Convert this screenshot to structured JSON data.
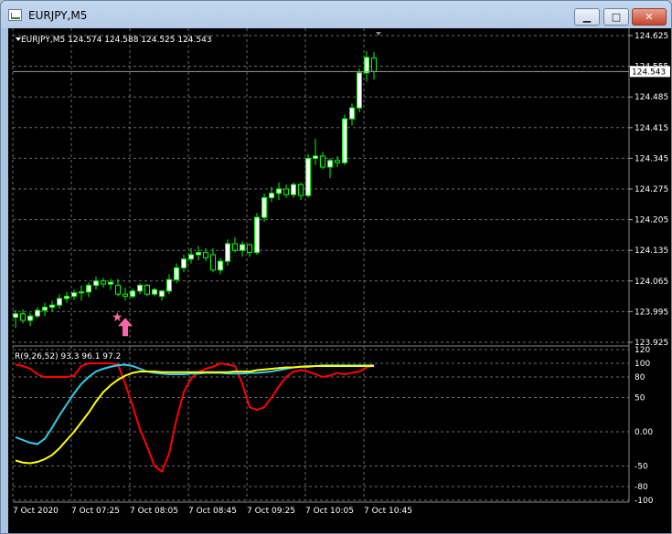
{
  "window": {
    "title": "EURJPY,M5",
    "min_glyph": "▁",
    "max_glyph": "□",
    "close_glyph": "✕"
  },
  "chart": {
    "symbol_line": "EURJPY,M5  124.574 124.588 124.525 124.543",
    "current_price_label": "124.543",
    "hidden_label": "124.555",
    "indicator_label": "R(9,26,52) 93.3 96.1 97.2",
    "colors": {
      "background": "#000000",
      "grid": "#6b6b6b",
      "bull_body": "#ffffff",
      "candle_outline": "#00ff00",
      "bear_body": "#000000",
      "ind_red": "#ff0000",
      "ind_cyan": "#33ccee",
      "ind_yellow": "#ffff00",
      "arrow": "#ff66aa"
    }
  },
  "chart_data": [
    {
      "type": "candlestick",
      "title": "EURJPY,M5",
      "ohlc_header": [
        124.574,
        124.588,
        124.525,
        124.543
      ],
      "price_ticks": [
        "124.625",
        "124.555",
        "124.485",
        "124.415",
        "124.345",
        "124.275",
        "124.205",
        "124.135",
        "124.065",
        "123.995",
        "123.925"
      ],
      "ylim": [
        123.925,
        124.625
      ],
      "current_price": 124.543,
      "time_labels": [
        "7 Oct 2020",
        "7 Oct 07:25",
        "7 Oct 08:05",
        "7 Oct 08:45",
        "7 Oct 09:25",
        "7 Oct 10:05",
        "7 Oct 10:45"
      ],
      "grid": true,
      "candles": [
        [
          123.982,
          123.999,
          123.958,
          123.99
        ],
        [
          123.99,
          124.0,
          123.968,
          123.975
        ],
        [
          123.975,
          123.992,
          123.962,
          123.985
        ],
        [
          123.985,
          124.005,
          123.98,
          123.998
        ],
        [
          123.998,
          124.015,
          123.985,
          124.005
        ],
        [
          124.005,
          124.02,
          123.995,
          124.01
        ],
        [
          124.01,
          124.035,
          124.002,
          124.025
        ],
        [
          124.025,
          124.04,
          124.015,
          124.03
        ],
        [
          124.03,
          124.045,
          124.022,
          124.038
        ],
        [
          124.038,
          124.055,
          124.02,
          124.04
        ],
        [
          124.04,
          124.062,
          124.028,
          124.055
        ],
        [
          124.055,
          124.075,
          124.045,
          124.065
        ],
        [
          124.065,
          124.072,
          124.05,
          124.058
        ],
        [
          124.058,
          124.07,
          124.045,
          124.062
        ],
        [
          124.055,
          124.07,
          124.03,
          124.035
        ],
        [
          124.035,
          124.05,
          124.02,
          124.03
        ],
        [
          124.03,
          124.048,
          124.025,
          124.042
        ],
        [
          124.042,
          124.06,
          124.035,
          124.055
        ],
        [
          124.055,
          124.058,
          124.03,
          124.035
        ],
        [
          124.035,
          124.05,
          124.03,
          124.045
        ],
        [
          124.03,
          124.045,
          124.02,
          124.042
        ],
        [
          124.042,
          124.08,
          124.035,
          124.068
        ],
        [
          124.068,
          124.105,
          124.06,
          124.095
        ],
        [
          124.095,
          124.125,
          124.085,
          124.115
        ],
        [
          124.115,
          124.14,
          124.105,
          124.125
        ],
        [
          124.125,
          124.145,
          124.112,
          124.13
        ],
        [
          124.13,
          124.14,
          124.11,
          124.118
        ],
        [
          124.125,
          124.14,
          124.085,
          124.09
        ],
        [
          124.09,
          124.118,
          124.08,
          124.11
        ],
        [
          124.11,
          124.16,
          124.1,
          124.15
        ],
        [
          124.15,
          124.165,
          124.13,
          124.135
        ],
        [
          124.135,
          124.155,
          124.12,
          124.148
        ],
        [
          124.148,
          124.15,
          124.12,
          124.13
        ],
        [
          124.13,
          124.22,
          124.125,
          124.21
        ],
        [
          124.21,
          124.265,
          124.2,
          124.255
        ],
        [
          124.255,
          124.28,
          124.245,
          124.265
        ],
        [
          124.265,
          124.29,
          124.25,
          124.275
        ],
        [
          124.275,
          124.285,
          124.255,
          124.262
        ],
        [
          124.262,
          124.29,
          124.255,
          124.285
        ],
        [
          124.285,
          124.29,
          124.25,
          124.26
        ],
        [
          124.26,
          124.355,
          124.255,
          124.345
        ],
        [
          124.345,
          124.39,
          124.33,
          124.35
        ],
        [
          124.35,
          124.36,
          124.32,
          124.325
        ],
        [
          124.325,
          124.345,
          124.3,
          124.34
        ],
        [
          124.34,
          124.35,
          124.325,
          124.335
        ],
        [
          124.335,
          124.445,
          124.33,
          124.435
        ],
        [
          124.435,
          124.47,
          124.42,
          124.46
        ],
        [
          124.46,
          124.55,
          124.45,
          124.54
        ],
        [
          124.54,
          124.59,
          124.52,
          124.575
        ],
        [
          124.574,
          124.588,
          124.525,
          124.543
        ]
      ],
      "markers": [
        {
          "type": "star",
          "candle": 14,
          "price": 123.983
        },
        {
          "type": "up-arrow",
          "candle": 15,
          "price": 123.96
        }
      ]
    },
    {
      "type": "line",
      "title": "R(9,26,52)",
      "current_values": [
        93.3,
        96.1,
        97.2
      ],
      "ylim": [
        -100,
        120
      ],
      "y_ticks": [
        "120",
        "100",
        "80",
        "50",
        "0.00",
        "-50",
        "-80",
        "-100"
      ],
      "series": [
        {
          "color": "#ff0000",
          "values": [
            98,
            96,
            92,
            84,
            80,
            80,
            80,
            80,
            82,
            96,
            100,
            100,
            100,
            100,
            98,
            70,
            38,
            4,
            -22,
            -50,
            -58,
            -32,
            18,
            58,
            78,
            87,
            92,
            95,
            100,
            98,
            96,
            70,
            36,
            32,
            36,
            50,
            66,
            80,
            88,
            90,
            88,
            84,
            80,
            82,
            86,
            84,
            86,
            88,
            94,
            98
          ]
        },
        {
          "color": "#33ccee",
          "values": [
            -8,
            -12,
            -16,
            -18,
            -10,
            6,
            24,
            40,
            56,
            70,
            80,
            88,
            92,
            95,
            97,
            98,
            96,
            92,
            88,
            86,
            85,
            84,
            84,
            84,
            85,
            85,
            86,
            86,
            86,
            85,
            85,
            85,
            86,
            86,
            87,
            88,
            90,
            92,
            94,
            95,
            96,
            96,
            97,
            97,
            97,
            97,
            97,
            97,
            97,
            97
          ]
        },
        {
          "color": "#ffff00",
          "values": [
            -42,
            -45,
            -46,
            -44,
            -40,
            -34,
            -24,
            -12,
            0,
            14,
            28,
            44,
            58,
            68,
            76,
            82,
            86,
            88,
            88,
            88,
            87,
            87,
            87,
            87,
            87,
            87,
            87,
            87,
            87,
            87,
            88,
            88,
            88,
            90,
            91,
            92,
            93,
            94,
            94,
            95,
            95,
            96,
            96,
            96,
            96,
            96,
            96,
            96,
            96,
            96
          ]
        }
      ]
    }
  ]
}
